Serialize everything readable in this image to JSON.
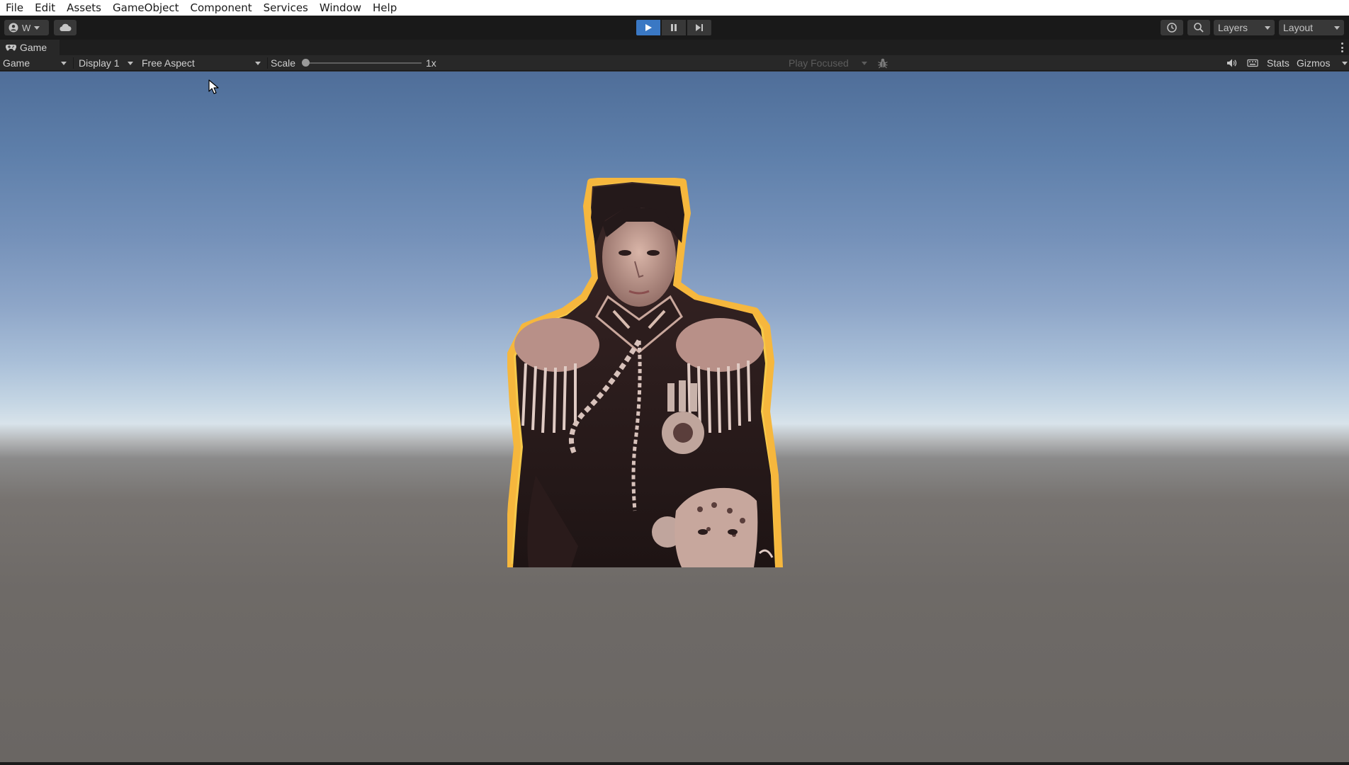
{
  "menubar": {
    "items": [
      "File",
      "Edit",
      "Assets",
      "GameObject",
      "Component",
      "Services",
      "Window",
      "Help"
    ]
  },
  "toolbar": {
    "account_label": "W",
    "account_icon": "account-icon",
    "cloud_icon": "cloud-icon",
    "play_icon": "play-icon",
    "pause_icon": "pause-icon",
    "step_icon": "step-icon",
    "play_state": "playing",
    "history_icon": "history-icon",
    "search_icon": "search-icon",
    "layers_label": "Layers",
    "layout_label": "Layout",
    "accent_color": "#3a78c4"
  },
  "tab": {
    "title": "Game",
    "icon": "gamepad-icon"
  },
  "controlbar": {
    "mode": "Game",
    "display": "Display 1",
    "aspect": "Free Aspect",
    "scale_label": "Scale",
    "scale_value": "1x",
    "scale_level": 0,
    "play_mode": "Play Focused",
    "stats_label": "Stats",
    "gizmos_label": "Gizmos"
  },
  "viewport": {
    "sky_top_color": "#4f6e99",
    "horizon_color": "#d8e3ea",
    "ground_color": "#6a6663",
    "sprite": "character-sprite"
  }
}
